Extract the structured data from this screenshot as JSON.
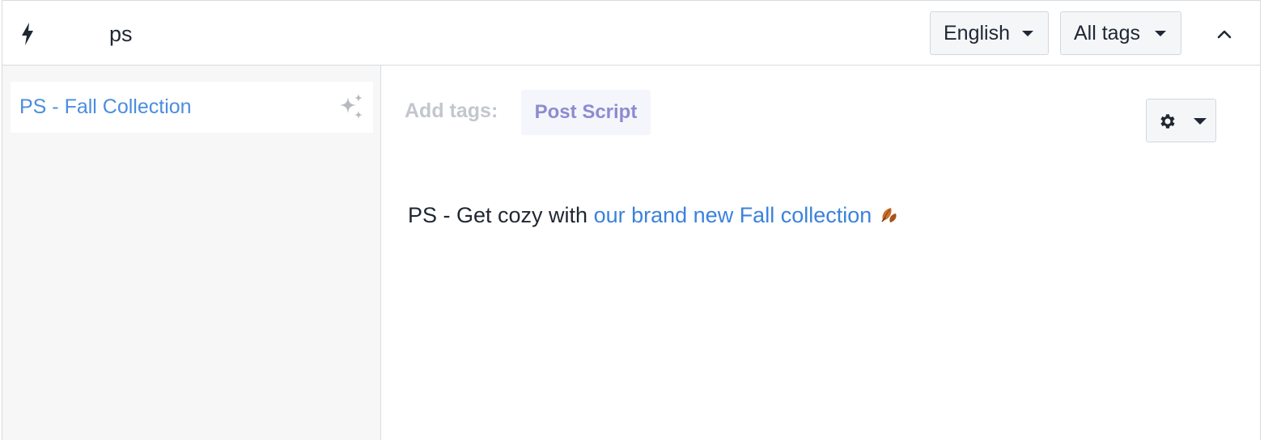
{
  "header": {
    "search_value": "ps",
    "language_dropdown": "English",
    "tags_dropdown": "All tags"
  },
  "sidebar": {
    "items": [
      {
        "label": "PS - Fall Collection",
        "icon": "sparkles-icon"
      }
    ]
  },
  "main": {
    "add_tags_label": "Add tags:",
    "tag": "Post Script",
    "message_prefix": "PS - Get cozy with ",
    "message_link": "our brand new Fall collection",
    "message_emoji": "fallen-leaf-icon"
  },
  "colors": {
    "link": "#3b82dc",
    "sidebar_link": "#4b8de0",
    "tag_text": "#8d8bd0",
    "sidebar_bg": "#f7f7f8",
    "text": "#1f2733"
  }
}
